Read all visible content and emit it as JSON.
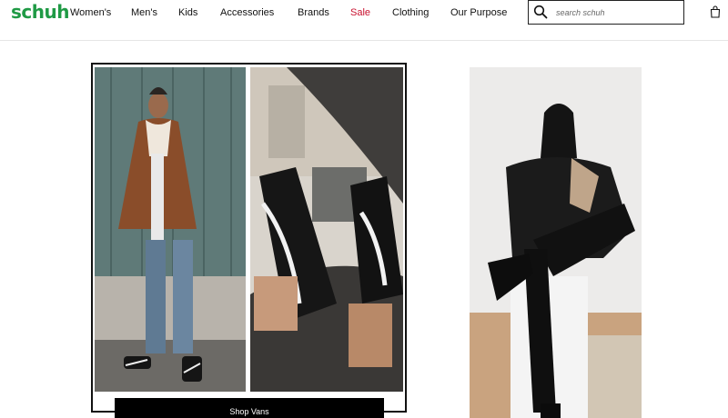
{
  "header": {
    "logo": "schuh",
    "nav": [
      {
        "label": "Women's",
        "name": "nav-womens"
      },
      {
        "label": "Men's",
        "name": "nav-mens"
      },
      {
        "label": "Kids",
        "name": "nav-kids"
      },
      {
        "label": "Accessories",
        "name": "nav-accessories"
      },
      {
        "label": "Brands",
        "name": "nav-brands"
      },
      {
        "label": "Sale",
        "name": "nav-sale"
      },
      {
        "label": "Clothing",
        "name": "nav-clothing"
      },
      {
        "label": "Our Purpose",
        "name": "nav-our-purpose"
      }
    ],
    "search": {
      "placeholder": "search schuh"
    },
    "icons": {
      "search": "search-icon",
      "bag": "shopping-bag-icon"
    }
  },
  "promo": {
    "button_label": "Shop Vans"
  },
  "colors": {
    "brand": "#1f9a45",
    "sale": "#c8102e",
    "button_bg": "#000000",
    "button_text": "#ffffff"
  }
}
